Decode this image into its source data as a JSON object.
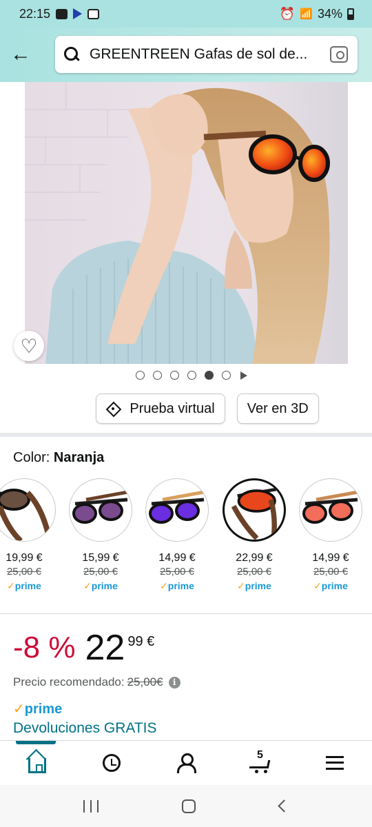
{
  "status_bar": {
    "time": "22:15",
    "battery": "34%",
    "icons": [
      "notification-icon",
      "play-icon",
      "image-icon",
      "alarm-icon",
      "wifi-icon",
      "signal-icon",
      "battery-icon"
    ]
  },
  "search": {
    "query": "GREENTREEN Gafas de sol de..."
  },
  "gallery": {
    "dot_count": 6,
    "active_dot": 5
  },
  "actions": {
    "virtual_tryon": "Prueba virtual",
    "view_3d": "Ver en 3D"
  },
  "color": {
    "label": "Color:",
    "selected": "Naranja"
  },
  "variants": [
    {
      "price": "19,99 €",
      "old_price": "25,00 €",
      "prime": "prime",
      "frame": "#3a2a22",
      "lens": "#6a5040"
    },
    {
      "price": "15,99 €",
      "old_price": "25,00 €",
      "prime": "prime",
      "frame": "#1a1a1a",
      "lens": "#7b4b8f"
    },
    {
      "price": "14,99 €",
      "old_price": "25,00 €",
      "prime": "prime",
      "frame": "#1a1a1a",
      "lens": "#6b2ee0"
    },
    {
      "price": "22,99 €",
      "old_price": "25,00 €",
      "prime": "prime",
      "frame": "#1a1a1a",
      "lens": "#e8461c",
      "selected": true
    },
    {
      "price": "14,99 €",
      "old_price": "25,00 €",
      "prime": "prime",
      "frame": "#1a1a1a",
      "lens": "#f26d5a"
    }
  ],
  "pricing": {
    "discount": "-8 %",
    "whole": "22",
    "fraction": "99 €",
    "recommended_label": "Precio recomendado:",
    "recommended_value": "25,00€"
  },
  "prime_label": "prime",
  "returns": "Devoluciones GRATIS",
  "bottom_nav": {
    "cart_count": "5",
    "items": [
      "home-icon",
      "history-icon",
      "account-icon",
      "cart-icon",
      "menu-icon"
    ]
  },
  "colors": {
    "accent_teal": "#007185",
    "discount_red": "#cc0c39",
    "prime_blue": "#1a98d5",
    "prime_orange": "#f7a21a",
    "header_bg": "#a9e2e0"
  }
}
